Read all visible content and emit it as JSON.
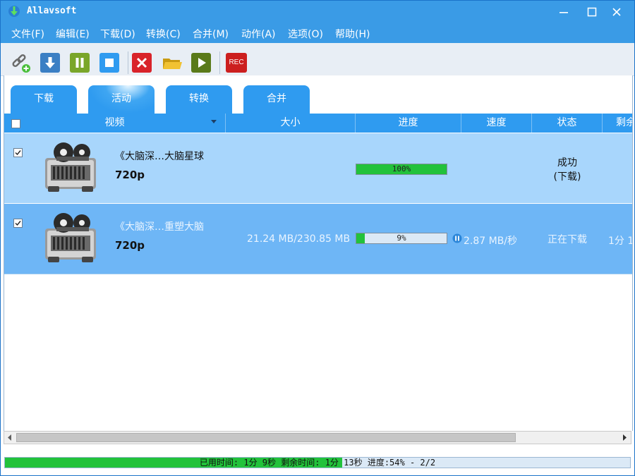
{
  "window": {
    "title": "Allavsoft"
  },
  "menu": [
    "文件(F)",
    "编辑(E)",
    "下载(D)",
    "转换(C)",
    "合并(M)",
    "动作(A)",
    "选项(O)",
    "帮助(H)"
  ],
  "toolbar": {
    "icons": [
      "add-url-icon",
      "download-icon",
      "pause-icon",
      "stop-icon",
      "delete-icon",
      "open-folder-icon",
      "play-icon",
      "record-icon"
    ],
    "rec_label": "REC",
    "colors": {
      "download": "#3b7fc4",
      "pause": "#7aa62a",
      "stop": "#2f9bf0",
      "delete": "#d9232a",
      "play": "#5a7a1a",
      "rec": "#cc1f1f"
    }
  },
  "tabs": [
    {
      "label": "下载",
      "active": false
    },
    {
      "label": "活动",
      "active": true
    },
    {
      "label": "转换",
      "active": false
    },
    {
      "label": "合并",
      "active": false
    }
  ],
  "columns": [
    "视频",
    "大小",
    "进度",
    "速度",
    "状态",
    "剩余"
  ],
  "rows": [
    {
      "checked": true,
      "title": "《大脑深…大脑星球",
      "quality": "720p",
      "size": "",
      "progress": 1.0,
      "progress_label": "100%",
      "speed": "",
      "status": "成功",
      "status_detail": "(下载)",
      "remaining": ""
    },
    {
      "checked": true,
      "title": "《大脑深…重塑大脑",
      "quality": "720p",
      "size": "21.24 MB/230.85 MB",
      "progress": 0.09,
      "progress_label": "9%",
      "speed": "2.87 MB/秒",
      "status": "正在下载",
      "status_detail": "",
      "remaining": "1分 1"
    }
  ],
  "statusbar": {
    "text": "已用时间: 1分 9秒 剩余时间: 1分 13秒 进度:54% - 2/2",
    "progress": 0.54
  },
  "colors": {
    "titlebar": "#3a9be6",
    "tab": "#2f9bf0",
    "row_done": "#a8d6fc",
    "row_active": "#6eb6f6",
    "progress_fill": "#22c23b"
  }
}
